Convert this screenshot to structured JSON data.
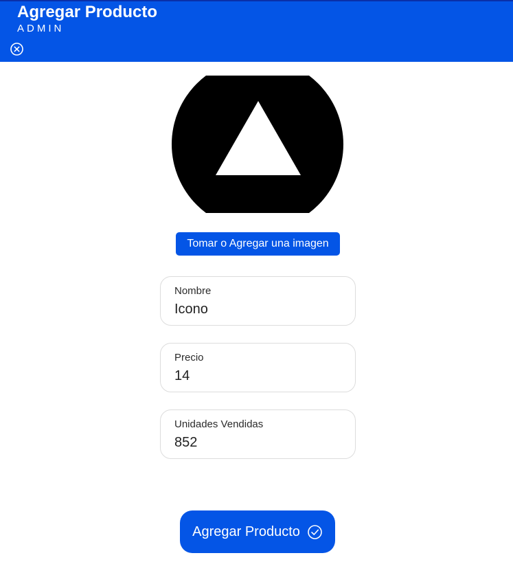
{
  "header": {
    "title": "Agregar Producto",
    "subtitle": "ADMIN",
    "close_icon": "close-circle-icon",
    "background": "#0455e6"
  },
  "image": {
    "icon": "triangle-logo-icon"
  },
  "add_image_button": {
    "label": "Tomar o Agregar una imagen"
  },
  "form": {
    "nombre": {
      "label": "Nombre",
      "value": "Icono"
    },
    "precio": {
      "label": "Precio",
      "value": "14"
    },
    "unidades": {
      "label": "Unidades Vendidas",
      "value": "852"
    }
  },
  "submit_button": {
    "label": "Agregar Producto",
    "icon": "checkmark-circle-icon"
  },
  "colors": {
    "accent": "#0455e6",
    "field_border": "#dcdcdc"
  }
}
